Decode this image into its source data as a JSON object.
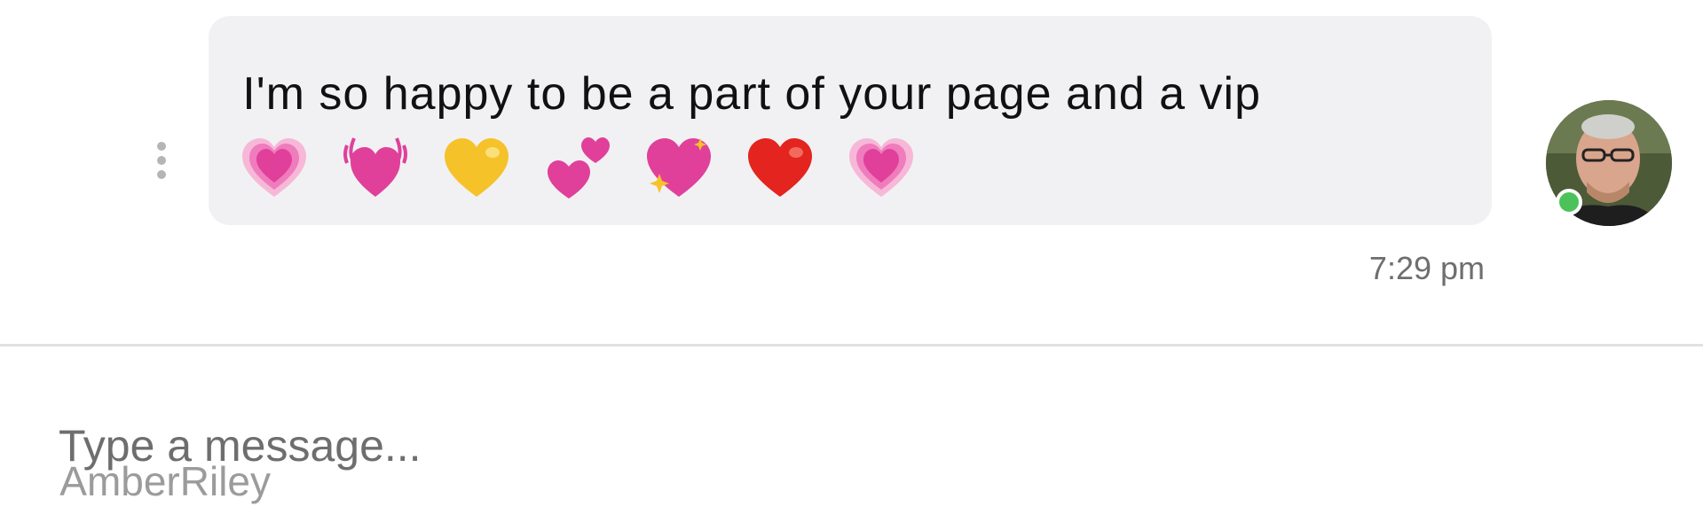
{
  "message": {
    "text": "I'm so happy to be a part of your page and a vip",
    "time": "7:29 pm",
    "sender_online": true,
    "emojis": [
      "growing-heart-icon",
      "beating-heart-icon",
      "yellow-heart-icon",
      "two-hearts-icon",
      "sparkling-heart-icon",
      "red-heart-icon",
      "growing-heart-icon"
    ]
  },
  "composer": {
    "placeholder": "Type a message..."
  },
  "watermark": "AmberRiley",
  "colors": {
    "bubble": "#f1f1f3",
    "online": "#4cc35a",
    "pink_heart": "#e0409a",
    "red_heart": "#e3241f",
    "yellow_heart": "#f5c22a"
  }
}
